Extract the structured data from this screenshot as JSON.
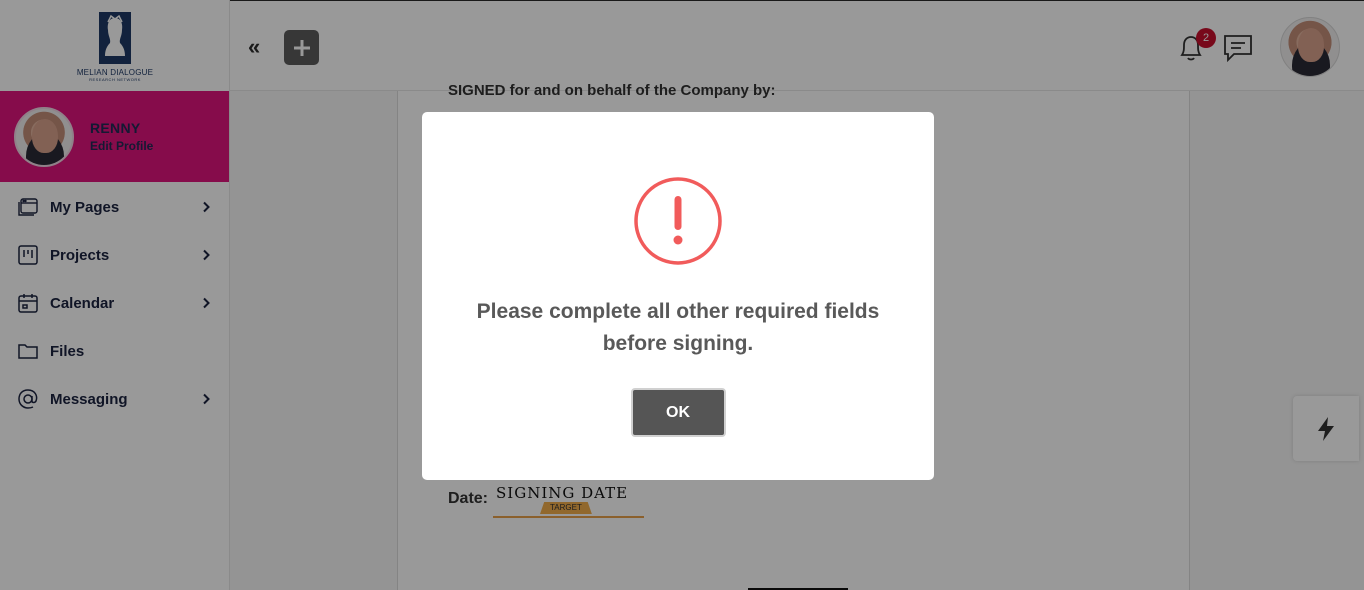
{
  "app": {
    "logo_text": "MELIAN DIALOGUE",
    "logo_subtext": "RESEARCH NETWORK"
  },
  "profile": {
    "name": "RENNY",
    "edit_label": "Edit Profile"
  },
  "sidebar": {
    "items": [
      {
        "label": "My Pages",
        "icon": "pages-icon",
        "has_chevron": true
      },
      {
        "label": "Projects",
        "icon": "board-icon",
        "has_chevron": true
      },
      {
        "label": "Calendar",
        "icon": "calendar-icon",
        "has_chevron": true
      },
      {
        "label": "Files",
        "icon": "folder-icon",
        "has_chevron": false
      },
      {
        "label": "Messaging",
        "icon": "at-sign-icon",
        "has_chevron": true
      }
    ]
  },
  "topbar": {
    "collapse_glyph": "«",
    "notification_count": "2"
  },
  "document": {
    "heading": "SIGNED for and on behalf of the Company by:",
    "date_label": "Date:",
    "signing_date_value": "SIGNING DATE",
    "signing_date_tag": "TARGET"
  },
  "modal": {
    "message": "Please complete all other required fields before signing.",
    "ok_label": "OK",
    "icon": "warning-exclamation-icon"
  },
  "colors": {
    "profile_bg": "#e0147e",
    "nav_text": "#1c2340",
    "warning": "#f15b5b",
    "badge": "#c8102e",
    "signing_tag": "#f2ae4b"
  }
}
